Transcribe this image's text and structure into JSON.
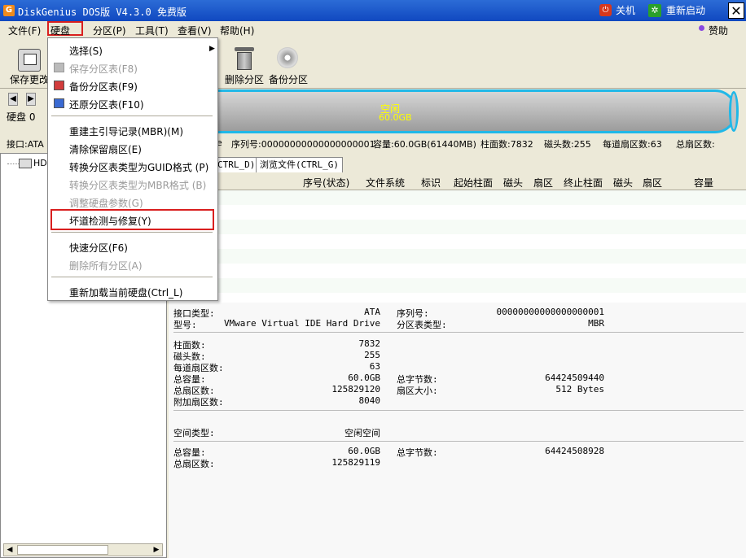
{
  "titlebar": {
    "title": "DiskGenius DOS版 V4.3.0 免费版",
    "app_icon": "G",
    "shutdown_label": "关机",
    "restart_label": "重新启动",
    "close_icon": "✕"
  },
  "menubar": {
    "file": "文件(F)",
    "disk": "硬盘(D)",
    "partition": "分区(P)",
    "tools": "工具(T)",
    "view": "查看(V)",
    "help": "帮助(H)",
    "donate": "赞助"
  },
  "toolbar": {
    "save": "保存更改",
    "delete_partition": "删除分区",
    "backup_partition": "备份分区"
  },
  "disk_nav": {
    "label": "硬盘 0",
    "interface": "接口:ATA"
  },
  "diskbar": {
    "status": "空闲",
    "size": "60.0GB"
  },
  "diskinfo": {
    "model_tail": "e",
    "serial": "序列号:00000000000000000001",
    "capacity": "容量:60.0GB(61440MB)",
    "cylinders": "柱面数:7832",
    "heads": "磁头数:255",
    "sectors_per_track": "每道扇区数:63",
    "total_sectors": "总扇区数:"
  },
  "tree": {
    "hd_label": "HD1"
  },
  "tabs": {
    "partition_params_tail": "CTRL_D)",
    "browse_files": "浏览文件(CTRL_G)"
  },
  "table": {
    "headers": [
      "序号(状态)",
      "文件系统",
      "标识",
      "起始柱面",
      "磁头",
      "扇区",
      "终止柱面",
      "磁头",
      "扇区",
      "容量"
    ]
  },
  "details": {
    "interface_type_label": "接口类型:",
    "interface_type_value": "ATA",
    "serial_label": "序列号:",
    "serial_value": "00000000000000000001",
    "model_label": "型号:",
    "model_value": "VMware Virtual IDE Hard Drive",
    "ptable_label": "分区表类型:",
    "ptable_value": "MBR",
    "cylinders_label": "柱面数:",
    "cylinders_value": "7832",
    "heads_label": "磁头数:",
    "heads_value": "255",
    "spt_label": "每道扇区数:",
    "spt_value": "63",
    "capacity_label": "总容量:",
    "capacity_value": "60.0GB",
    "total_bytes_label": "总字节数:",
    "total_bytes_value": "64424509440",
    "total_sectors_label": "总扇区数:",
    "total_sectors_value": "125829120",
    "sector_size_label": "扇区大小:",
    "sector_size_value": "512 Bytes",
    "extra_sectors_label": "附加扇区数:",
    "extra_sectors_value": "8040",
    "space_type_label": "空间类型:",
    "space_type_value": "空闲空间",
    "free_capacity_label": "总容量:",
    "free_capacity_value": "60.0GB",
    "free_bytes_label": "总字节数:",
    "free_bytes_value": "64424508928",
    "free_sectors_label": "总扇区数:",
    "free_sectors_value": "125829119"
  },
  "dropdown": {
    "select": "选择(S)",
    "save_ptable": "保存分区表(F8)",
    "backup_ptable": "备份分区表(F9)",
    "restore_ptable": "还原分区表(F10)",
    "rebuild_mbr": "重建主引导记录(MBR)(M)",
    "clear_reserved": "清除保留扇区(E)",
    "convert_guid": "转换分区表类型为GUID格式 (P)",
    "convert_mbr": "转换分区表类型为MBR格式 (B)",
    "adjust_params": "调整硬盘参数(G)",
    "bad_sector": "坏道检测与修复(Y)",
    "quick_partition": "快速分区(F6)",
    "delete_all": "删除所有分区(A)",
    "reload_disk": "重新加载当前硬盘(Ctrl_L)"
  },
  "colors": {
    "titlebar": "#1a58c8",
    "disk_free": "#b0b0b0",
    "disk_border": "#20b8e8",
    "highlight_box": "#d91f1f"
  }
}
